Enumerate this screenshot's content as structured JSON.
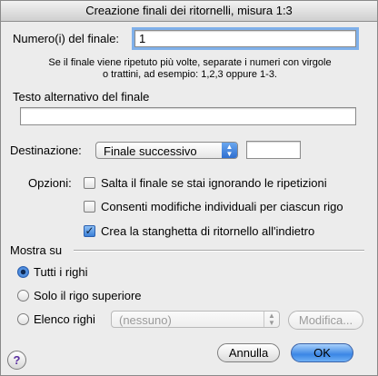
{
  "window": {
    "title": "Creazione finali dei ritornelli, misura 1:3"
  },
  "ending_number": {
    "label": "Numero(i) del finale:",
    "value": "1",
    "hint_line1": "Se il finale viene ripetuto più volte, separate i numeri con virgole",
    "hint_line2": "o trattini, ad esempio: 1,2,3 oppure 1-3."
  },
  "alt_text": {
    "label": "Testo alternativo del finale",
    "value": ""
  },
  "destination": {
    "label": "Destinazione:",
    "selected": "Finale successivo",
    "value": ""
  },
  "options": {
    "label": "Opzioni:",
    "items": [
      {
        "label": "Salta il finale se stai ignorando le ripetizioni",
        "checked": false
      },
      {
        "label": "Consenti modifiche individuali per ciascun rigo",
        "checked": false
      },
      {
        "label": "Crea la stanghetta di ritornello all'indietro",
        "checked": true
      }
    ]
  },
  "show_on": {
    "label": "Mostra su",
    "options": [
      {
        "label": "Tutti i righi",
        "selected": true
      },
      {
        "label": "Solo il rigo superiore",
        "selected": false
      },
      {
        "label": "Elenco righi",
        "selected": false
      }
    ],
    "staff_list": "(nessuno)",
    "edit_label": "Modifica..."
  },
  "buttons": {
    "help": "?",
    "cancel": "Annulla",
    "ok": "OK"
  }
}
